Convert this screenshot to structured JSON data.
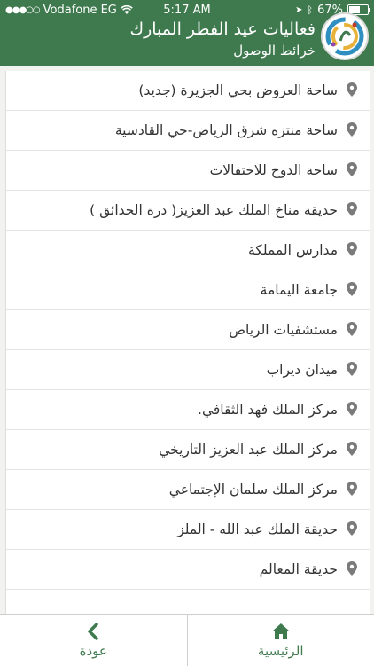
{
  "status": {
    "carrier": "Vodafone EG",
    "time": "5:17 AM",
    "battery": "67%",
    "battery_level": 0.67
  },
  "header": {
    "title": "فعاليات عيد الفطر المبارك",
    "subtitle": "خرائط الوصول"
  },
  "locations": [
    {
      "label": "ساحة العروض بحي الجزيرة (جديد)"
    },
    {
      "label": "ساحة منتزه شرق الرياض-حي القادسية"
    },
    {
      "label": "ساحة الدوح للاحتفالات"
    },
    {
      "label": "حديقة مناخ الملك عبد العزيز( درة الحدائق )"
    },
    {
      "label": "مدارس المملكة"
    },
    {
      "label": "جامعة اليمامة"
    },
    {
      "label": "مستشفيات الرياض"
    },
    {
      "label": "ميدان ديراب"
    },
    {
      "label": "مركز الملك فهد الثقافي."
    },
    {
      "label": "مركز الملك عبد العزيز التاريخي"
    },
    {
      "label": "مركز الملك سلمان الإجتماعي"
    },
    {
      "label": "حديقة الملك عبد الله - الملز"
    },
    {
      "label": "حديقة المعالم"
    }
  ],
  "tabs": {
    "back_label": "عودة",
    "home_label": "الرئيسية"
  },
  "colors": {
    "primary": "#3e7a4e",
    "pin": "#7a7a7a"
  }
}
